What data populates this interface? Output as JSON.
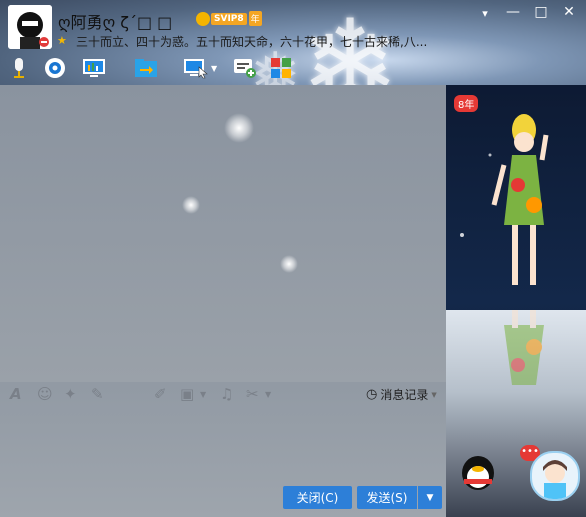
{
  "profile": {
    "nickname": "ღ阿勇ღ ζ´□ □",
    "vip_badge": "SVIP8",
    "vip_year": "年",
    "signature": "三十而立、四十为惑。五十而知天命，六十花甲，七十古来稀,八..."
  },
  "window": {
    "min": "▾",
    "minimize": "—",
    "maximize": "□",
    "close": "✕"
  },
  "toolbar_icons": [
    "mic-icon",
    "camera-icon",
    "screen-share-icon",
    "file-transfer-icon",
    "remote-desktop-icon",
    "add-app-icon",
    "apps-icon"
  ],
  "format_icons": [
    "font-icon",
    "emoji-icon",
    "shake-icon",
    "voice-icon",
    "edit-icon",
    "image-icon",
    "music-icon",
    "scissors-icon"
  ],
  "history_label": "消息记录",
  "buttons": {
    "close": "关闭(C)",
    "send": "发送(S)"
  },
  "side": {
    "year_badge": "8年"
  },
  "colors": {
    "accent": "#2d7fd8",
    "vip": "#f4a623"
  }
}
